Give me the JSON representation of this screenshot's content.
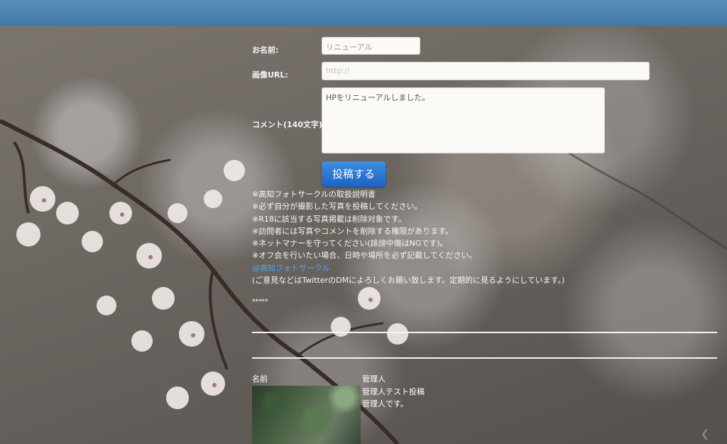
{
  "form": {
    "name_label": "お名前:",
    "name_value": "リニューアル",
    "image_url_label": "画像URL:",
    "image_url_placeholder": "http://",
    "comment_label": "コメント(140文字):",
    "comment_value": "HPをリニューアルしました。",
    "submit_label": "投稿する"
  },
  "notes": [
    "※高知フォトサークルの取扱説明書",
    "※必ず自分が撮影した写真を投稿してください。",
    "※R18に該当する写真掲載は削除対象です。",
    "※訪問者には写真やコメントを削除する権限があります。",
    "※ネットマナーを守ってください(誹謗中傷はNGです)。",
    "※オフ会を行いたい場合、日時や場所を必ず記載してください。"
  ],
  "twitter_link": "@高知フォトサークル",
  "contact_note": "(ご意見などはTwitterのDMによろしくお願い致します。定期的に見るようにしています。)",
  "separator": "*****",
  "post": {
    "name_label": "名前",
    "author": "管理人",
    "title": "管理人テスト投稿",
    "body": "管理人です。"
  }
}
